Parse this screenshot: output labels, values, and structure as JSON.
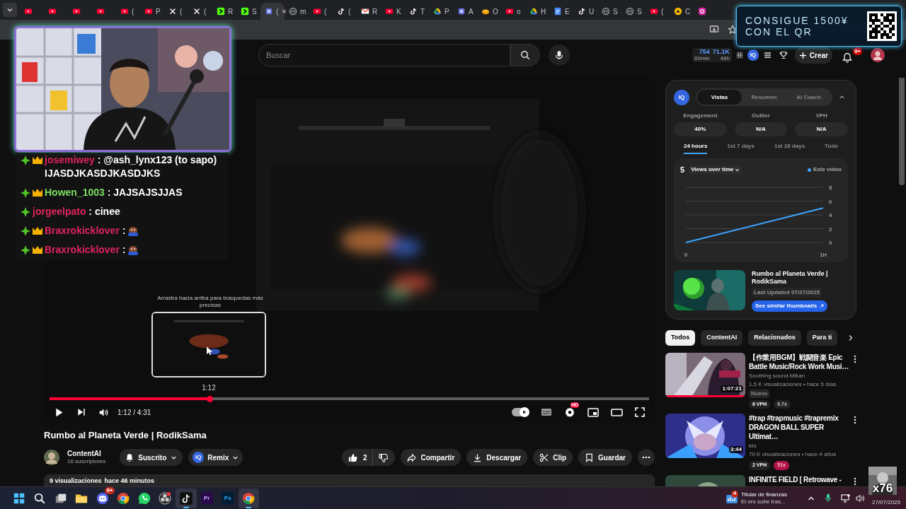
{
  "browser": {
    "tabs": [
      {
        "kind": "youtube",
        "selected": false
      },
      {
        "kind": "youtube",
        "selected": false
      },
      {
        "kind": "youtube",
        "selected": false
      },
      {
        "kind": "youtube",
        "selected": false
      },
      {
        "kind": "youtube",
        "label": "(",
        "selected": false
      },
      {
        "kind": "youtube",
        "label": "P",
        "selected": false
      },
      {
        "kind": "x",
        "label": "(",
        "selected": false
      },
      {
        "kind": "x",
        "label": "(",
        "selected": false
      },
      {
        "kind": "kick",
        "label": "R",
        "selected": false
      },
      {
        "kind": "kick",
        "label": "S",
        "selected": false
      },
      {
        "kind": "generic",
        "label": "(",
        "selected": true
      },
      {
        "kind": "globe",
        "label": "m",
        "selected": false
      },
      {
        "kind": "youtube",
        "label": "(",
        "selected": false
      },
      {
        "kind": "tiktok",
        "label": "(",
        "selected": false
      },
      {
        "kind": "mail",
        "label": "R",
        "selected": false
      },
      {
        "kind": "youtube",
        "label": "K",
        "selected": false
      },
      {
        "kind": "tiktok",
        "label": "T",
        "selected": false
      },
      {
        "kind": "drive",
        "label": "P",
        "selected": false
      },
      {
        "kind": "generic",
        "label": "A",
        "selected": false
      },
      {
        "kind": "orange",
        "label": "O",
        "selected": false
      },
      {
        "kind": "youtube",
        "label": "o",
        "selected": false
      },
      {
        "kind": "drive",
        "label": "H",
        "selected": false
      },
      {
        "kind": "doc",
        "label": "E",
        "selected": false
      },
      {
        "kind": "tiktok",
        "label": "U",
        "selected": false
      },
      {
        "kind": "globe",
        "label": "S",
        "selected": false
      },
      {
        "kind": "globe",
        "label": "S",
        "selected": false
      },
      {
        "kind": "youtube",
        "label": "(",
        "selected": false
      },
      {
        "kind": "yellow",
        "label": "C",
        "selected": false
      },
      {
        "kind": "instagram",
        "selected": false
      }
    ],
    "close_label": "×"
  },
  "qr_banner": {
    "lines": [
      "CONSIGUE 1500¥",
      "CON EL QR"
    ]
  },
  "header": {
    "search": {
      "placeholder": "Buscar"
    },
    "stats": [
      {
        "value": "754",
        "period": "60min"
      },
      {
        "value": "71.1K",
        "period": "48h"
      }
    ],
    "iq_logo": "IQ",
    "create_label": "Crear",
    "notifications": "9+"
  },
  "chat": [
    {
      "user": "josemiwey",
      "color": "#e0245e",
      "crown": true,
      "message": ": @ash_lynx123 (to sapo) IJASDJKASDJKASDJKS",
      "emote": false
    },
    {
      "user": "Howen_1003",
      "color": "#7ddf64",
      "crown": true,
      "message": ": JAJSAJSJJAS",
      "emote": false
    },
    {
      "user": "jorgeelpato",
      "color": "#e0245e",
      "crown": false,
      "message": ": cinee",
      "emote": false
    },
    {
      "user": "Braxrokicklover",
      "color": "#e0245e",
      "crown": true,
      "message": ":",
      "emote": true
    },
    {
      "user": "Braxrokicklover",
      "color": "#e0245e",
      "crown": true,
      "message": ":",
      "emote": true
    }
  ],
  "player": {
    "hint": "Arrastra hacia arriba para búsquedas más precisas",
    "preview_time": "1:12",
    "level": 0.267,
    "time": "1:12 / 4:31",
    "autoplay": true,
    "settings_badge": "HD"
  },
  "video": {
    "title": "Rumbo al Planeta Verde | RodikSama",
    "channel": "ContentAI",
    "subscribers": "16 suscriptores",
    "subscribe_label": "Suscrito",
    "remix_logo": "IQ",
    "remix_label": "Remix",
    "likes": "2",
    "actions": [
      {
        "kind": "share",
        "label": "Compartir"
      },
      {
        "kind": "download",
        "label": "Descargar"
      },
      {
        "kind": "clip",
        "label": "Clip"
      },
      {
        "kind": "save",
        "label": "Guardar"
      }
    ],
    "views": "9 visualizaciones",
    "age": "hace 46 minutos"
  },
  "iq_panel": {
    "logo": "IQ",
    "tabs": [
      {
        "label": "Vistas",
        "selected": true
      },
      {
        "label": "Resumen",
        "selected": false
      },
      {
        "label": "AI Coach",
        "selected": false
      }
    ],
    "metrics": [
      {
        "label": "Engagement",
        "value": "40%"
      },
      {
        "label": "Outlier",
        "value": "N/A"
      },
      {
        "label": "VPH",
        "value": "N/A"
      }
    ],
    "ranges": [
      {
        "label": "24 hours",
        "selected": true
      },
      {
        "label": "1st 7 days",
        "selected": false
      },
      {
        "label": "1st 28 days",
        "selected": false
      },
      {
        "label": "Todo",
        "selected": false
      }
    ],
    "count": "5",
    "chart_menu": "Views over time",
    "chart_data": {
      "type": "line",
      "x": [
        "0",
        "1H"
      ],
      "series": [
        {
          "name": "Este vídeo",
          "color": "#3ea6ff",
          "values": [
            0,
            5
          ]
        }
      ],
      "ylim": [
        0,
        8
      ],
      "yticks": [
        0,
        2,
        4,
        6,
        8
      ]
    },
    "video": {
      "title": "Rumbo al Planeta Verde | RodikSama",
      "updated": "Last Updated 07/27/2025",
      "button": "See similar thumbnails"
    }
  },
  "chips": [
    {
      "label": "Todos",
      "selected": true
    },
    {
      "label": "ContentAI",
      "selected": false
    },
    {
      "label": "Relacionados",
      "selected": false
    },
    {
      "label": "Para ti",
      "selected": false
    }
  ],
  "recommendations": [
    {
      "title": "【作業用BGM】戦闘音楽 Epic Battle Music/Rock Work Musi…",
      "channel": "Soothing sound Mikan",
      "meta": "1,5 K visualizaciones • hace 5 días",
      "duration": "1:07:21",
      "level": 1,
      "badge": "Nuevo",
      "vph": "6 VPH",
      "outlier": "0.7x",
      "highlight": false
    },
    {
      "title": "#trap #trapmusic #trapremix DRAGON BALL SUPER Ultimat…",
      "channel": "kto",
      "meta": "70 K visualizaciones • hace 4 años",
      "duration": "3:44",
      "vph": "2 VPH",
      "outlier": "51x",
      "highlight": true
    },
    {
      "title": "INFINITE FIELD [ Retrowave -"
    }
  ],
  "taskbar": {
    "apps": [
      {
        "kind": "start",
        "active": false
      },
      {
        "kind": "search",
        "active": false
      },
      {
        "kind": "taskview",
        "active": false
      },
      {
        "kind": "files",
        "active": false
      },
      {
        "kind": "discord",
        "badge": "9+",
        "active": false
      },
      {
        "kind": "chrome",
        "active": false
      },
      {
        "kind": "whatsapp",
        "active": false
      },
      {
        "kind": "obs",
        "active": false
      },
      {
        "kind": "tiktok",
        "active": true
      },
      {
        "kind": "premiere",
        "label": "Pr",
        "active": false
      },
      {
        "kind": "photoshop",
        "label": "Ps",
        "active": false
      },
      {
        "kind": "chrome",
        "active": true
      }
    ],
    "news": {
      "count": "4",
      "title": "Titular de finanzas",
      "subtitle": "El oro sube tras..."
    },
    "date": "27/07/2025",
    "overlay_label": "x76"
  }
}
